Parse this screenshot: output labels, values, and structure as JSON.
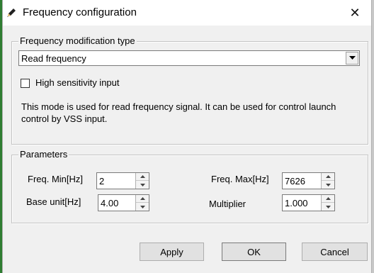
{
  "window": {
    "title": "Frequency configuration",
    "close_glyph": "✕"
  },
  "frequency_group": {
    "legend": "Frequency modification type",
    "selected_type": "Read frequency",
    "checkbox_label": "High sensitivity input",
    "checkbox_checked": false,
    "description": "This mode is used for read frequency signal. It can be used for control launch control by VSS input."
  },
  "parameters_group": {
    "legend": "Parameters",
    "freq_min_label": "Freq. Min[Hz]",
    "freq_min_value": "2",
    "freq_max_label": "Freq. Max[Hz]",
    "freq_max_value": "7626",
    "base_unit_label": "Base unit[Hz]",
    "base_unit_value": "4.00",
    "multiplier_label": "Multiplier",
    "multiplier_value": "1.000"
  },
  "buttons": {
    "apply": "Apply",
    "ok": "OK",
    "cancel": "Cancel"
  },
  "icons": {
    "title": "pencil-icon",
    "close": "close-icon",
    "dropdown": "chevron-down-icon",
    "spin_up": "triangle-up-icon",
    "spin_down": "triangle-down-icon"
  }
}
